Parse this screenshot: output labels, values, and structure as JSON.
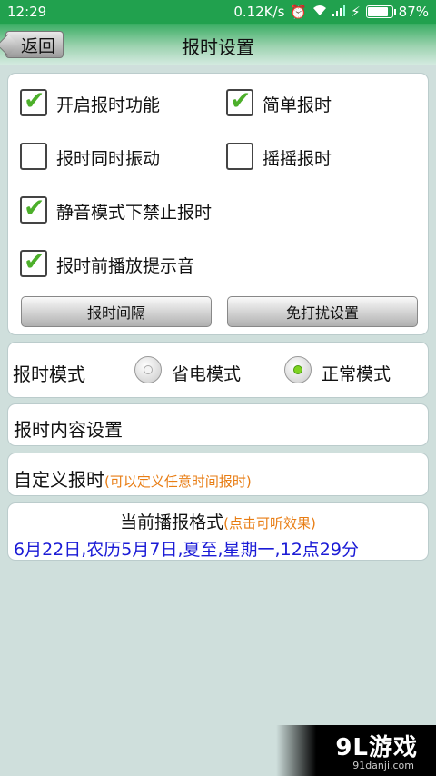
{
  "status": {
    "time": "12:29",
    "speed": "0.12K/s",
    "battery": "87%"
  },
  "header": {
    "back_label": "返回",
    "title": "报时设置"
  },
  "options": [
    {
      "label": "开启报时功能",
      "checked": true
    },
    {
      "label": "简单报时",
      "checked": true
    },
    {
      "label": "报时同时振动",
      "checked": false
    },
    {
      "label": "摇摇报时",
      "checked": false
    },
    {
      "label": "静音模式下禁止报时",
      "checked": true
    },
    {
      "label": "报时前播放提示音",
      "checked": true
    }
  ],
  "buttons": {
    "interval": "报时间隔",
    "dnd": "免打扰设置"
  },
  "mode": {
    "label": "报时模式",
    "power_saving": "省电模式",
    "normal": "正常模式",
    "selected": "正常模式"
  },
  "content_settings": {
    "label": "报时内容设置"
  },
  "custom": {
    "label": "自定义报时",
    "hint": "(可以定义任意时间报时)"
  },
  "format": {
    "title": "当前播报格式",
    "hint": "(点击可听效果)",
    "value": "6月22日,农历5月7日,夏至,星期一,12点29分"
  },
  "watermark": {
    "brand": "9L游戏",
    "site": "91danji.com"
  }
}
